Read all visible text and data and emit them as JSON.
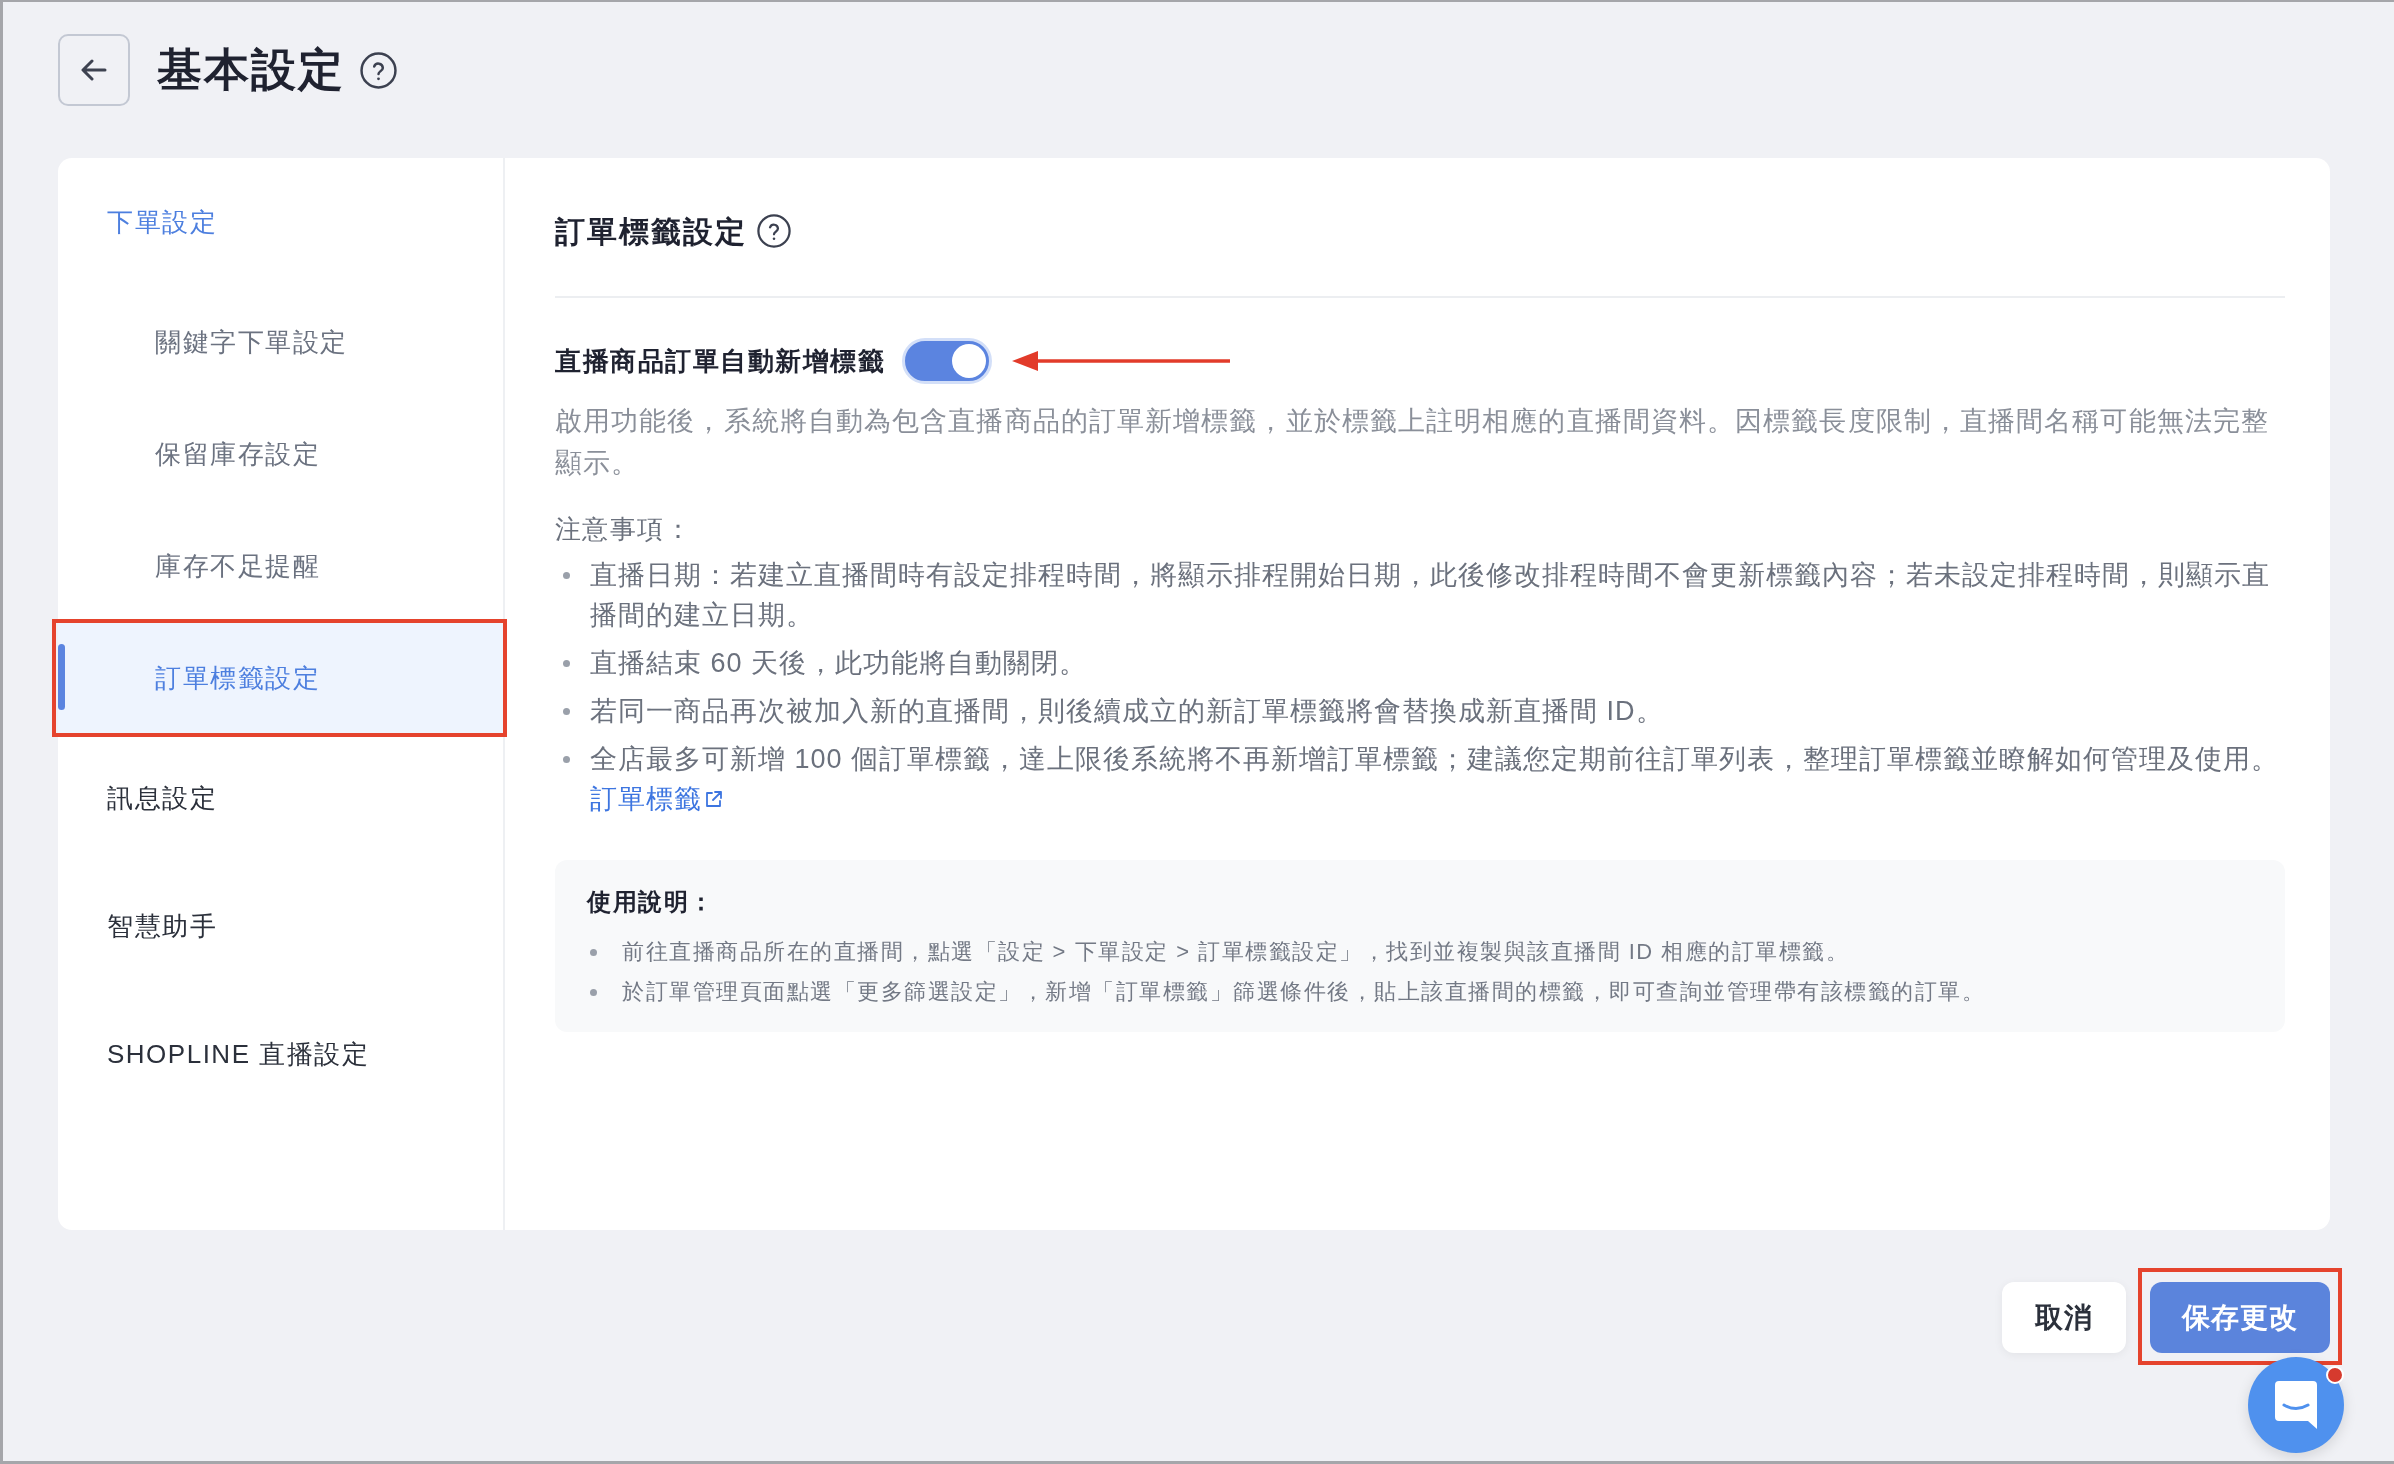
{
  "header": {
    "title": "基本設定"
  },
  "sidebar": {
    "items": [
      {
        "label": "下單設定",
        "selected": false,
        "children": [
          {
            "label": "關鍵字下單設定",
            "selected": false
          },
          {
            "label": "保留庫存設定",
            "selected": false
          },
          {
            "label": "庫存不足提醒",
            "selected": false
          },
          {
            "label": "訂單標籤設定",
            "selected": true
          }
        ]
      },
      {
        "label": "訊息設定",
        "selected": false
      },
      {
        "label": "智慧助手",
        "selected": false
      },
      {
        "label": "SHOPLINE 直播設定",
        "selected": false
      }
    ]
  },
  "panel": {
    "title": "訂單標籤設定",
    "toggle": {
      "label": "直播商品訂單自動新增標籤",
      "on": true
    },
    "description": "啟用功能後，系統將自動為包含直播商品的訂單新增標籤，並於標籤上註明相應的直播間資料。因標籤長度限制，直播間名稱可能無法完整顯示。",
    "notes": {
      "heading": "注意事項：",
      "items": [
        {
          "text": "直播日期：若建立直播間時有設定排程時間，將顯示排程開始日期，此後修改排程時間不會更新標籤內容；若未設定排程時間，則顯示直播間的建立日期。"
        },
        {
          "text": "直播結束 60 天後，此功能將自動關閉。"
        },
        {
          "text": "若同一商品再次被加入新的直播間，則後續成立的新訂單標籤將會替換成新直播間 ID。"
        },
        {
          "text": "全店最多可新增 100 個訂單標籤，達上限後系統將不再新增訂單標籤；建議您定期前往訂單列表，整理訂單標籤並瞭解如何管理及使用。",
          "link": "訂單標籤"
        }
      ]
    },
    "usage": {
      "heading": "使用說明：",
      "items": [
        "前往直播商品所在的直播間，點選「設定 > 下單設定 > 訂單標籤設定」，找到並複製與該直播間 ID 相應的訂單標籤。",
        "於訂單管理頁面點選「更多篩選設定」，新增「訂單標籤」篩選條件後，貼上該直播間的標籤，即可查詢並管理帶有該標籤的訂單。"
      ]
    }
  },
  "footer": {
    "buttons": [
      {
        "label": "取消",
        "kind": "secondary"
      },
      {
        "label": "保存更改",
        "kind": "primary"
      }
    ]
  }
}
